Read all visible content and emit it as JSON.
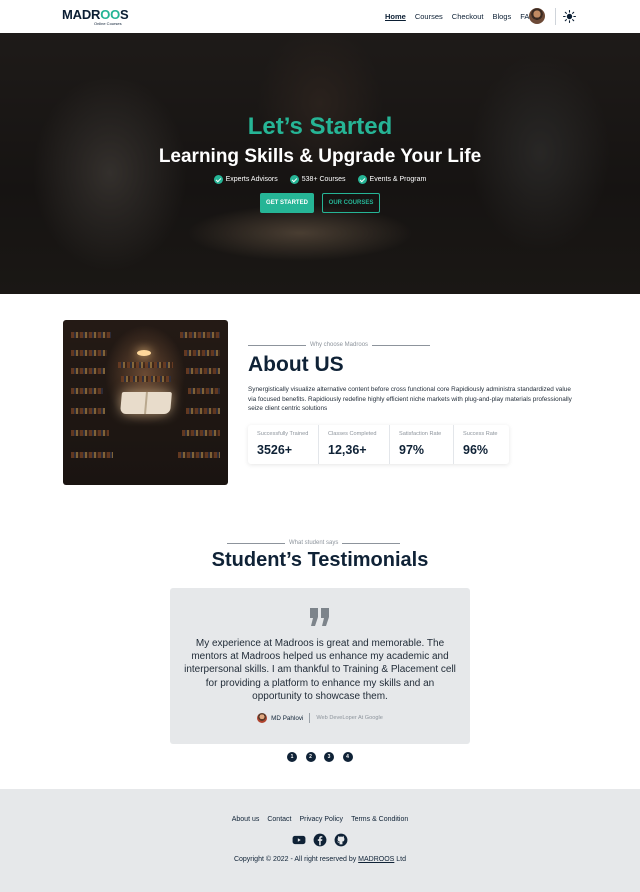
{
  "header": {
    "logo_text_main": "MADR",
    "logo_text_oo": "OO",
    "logo_text_end": "S",
    "logo_subtitle": "Online Courses",
    "nav": [
      "Home",
      "Courses",
      "Checkout",
      "Blogs",
      "FAQ"
    ],
    "active_nav": "Home"
  },
  "hero": {
    "title": "Let’s Started",
    "subtitle": "Learning Skills & Upgrade Your Life",
    "features": [
      "Experts Advisors",
      "538+ Courses",
      "Events & Program"
    ],
    "primary_button": "GET STARTED",
    "secondary_button": "OUR COURSES"
  },
  "about": {
    "kicker": "Why choose Madroos",
    "title": "About US",
    "text": "Synergistically visualize alternative content before cross functional core Rapidiously administra standardized value via focused benefits. Rapidiously redefine highly efficient niche markets with plug-and-play materials professionally seize client centric solutions",
    "stats": [
      {
        "label": "Successfully Trained",
        "value": "3526+"
      },
      {
        "label": "Classes Completed",
        "value": "12,36+"
      },
      {
        "label": "Satisfaction Rate",
        "value": "97%"
      },
      {
        "label": "Success Rate",
        "value": "96%"
      }
    ]
  },
  "testimonials": {
    "kicker": "What student says",
    "title": "Student’s Testimonials",
    "quote": "My experience at Madroos is great and memorable. The mentors at Madroos helped us enhance my academic and interpersonal skills. I am thankful to Training & Placement cell for providing a platform to enhance my skills and an opportunity to showcase them.",
    "author_name": "MD Pahlovi",
    "author_role": "Web DeveLoper At Google",
    "pages": [
      "1",
      "2",
      "3",
      "4"
    ]
  },
  "footer": {
    "links": [
      "About us",
      "Contact",
      "Privacy Policy",
      "Terms & Condition"
    ],
    "copyright_prefix": "Copyright © 2022 - All right reserved by ",
    "copyright_brand": "MADROOS",
    "copyright_suffix": " Ltd"
  },
  "colors": {
    "accent": "#26b596",
    "dark": "#0f2236",
    "footer_bg": "#e6e8ea"
  },
  "icons": [
    "check-icon",
    "sun-icon",
    "quote-icon",
    "youtube-icon",
    "facebook-icon",
    "github-icon"
  ]
}
